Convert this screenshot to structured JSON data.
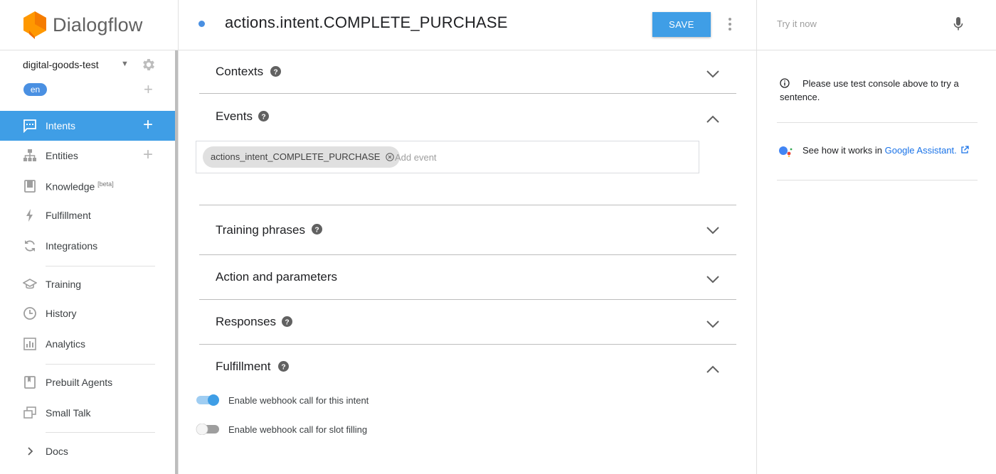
{
  "app": {
    "brand": "Dialogflow",
    "brand_color": "#ff9800"
  },
  "sidebar": {
    "agent_name": "digital-goods-test",
    "language": "en",
    "items": [
      {
        "label": "Intents",
        "icon": "chat-bubble-icon",
        "active": true
      },
      {
        "label": "Entities",
        "icon": "hierarchy-icon"
      },
      {
        "label": "Knowledge",
        "badge": "[beta]",
        "icon": "book-icon"
      },
      {
        "label": "Fulfillment",
        "icon": "bolt-icon"
      },
      {
        "label": "Integrations",
        "icon": "sync-icon"
      },
      {
        "label": "Training",
        "icon": "graduation-cap-icon"
      },
      {
        "label": "History",
        "icon": "clock-icon"
      },
      {
        "label": "Analytics",
        "icon": "bar-chart-icon"
      },
      {
        "label": "Prebuilt Agents",
        "icon": "bookmark-book-icon"
      },
      {
        "label": "Small Talk",
        "icon": "chat-windows-icon"
      },
      {
        "label": "Docs",
        "icon": "chevron-right-icon"
      }
    ]
  },
  "header": {
    "intent_title": "actions.intent.COMPLETE_PURCHASE",
    "save_label": "SAVE"
  },
  "sections": {
    "contexts": "Contexts",
    "events": "Events",
    "training": "Training phrases",
    "action": "Action and parameters",
    "responses": "Responses",
    "fulfillment": "Fulfillment"
  },
  "events": {
    "chip": "actions_intent_COMPLETE_PURCHASE",
    "placeholder": "Add event"
  },
  "fulfillment": {
    "webhook_label": "Enable webhook call for this intent",
    "webhook_enabled": true,
    "slot_label": "Enable webhook call for slot filling",
    "slot_enabled": false
  },
  "right_panel": {
    "try_placeholder": "Try it now",
    "info_text": "Please use test console above to try a sentence.",
    "ga_prefix": "See how it works in ",
    "ga_link": "Google Assistant."
  },
  "colors": {
    "accent": "#3f9ee6",
    "link": "#1a73e8"
  }
}
